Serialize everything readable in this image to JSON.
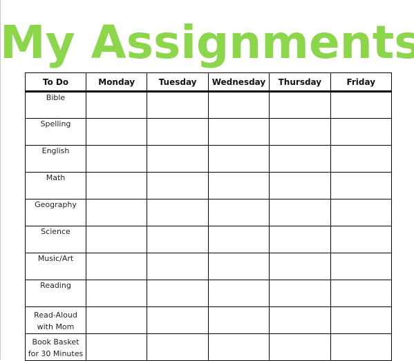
{
  "page": {
    "title": "My Assignments",
    "title_color": "#8bd64a"
  },
  "table": {
    "headers": [
      "To Do",
      "Monday",
      "Tuesday",
      "Wednesday",
      "Thursday",
      "Friday"
    ],
    "rows": [
      [
        "Bible"
      ],
      [
        "Spelling"
      ],
      [
        "English"
      ],
      [
        "Math"
      ],
      [
        "Geography"
      ],
      [
        "Science"
      ],
      [
        "Music/Art"
      ],
      [
        "Reading"
      ],
      [
        "Read-Aloud",
        "with Mom"
      ],
      [
        "Book Basket",
        "for 30 Minutes"
      ]
    ]
  }
}
